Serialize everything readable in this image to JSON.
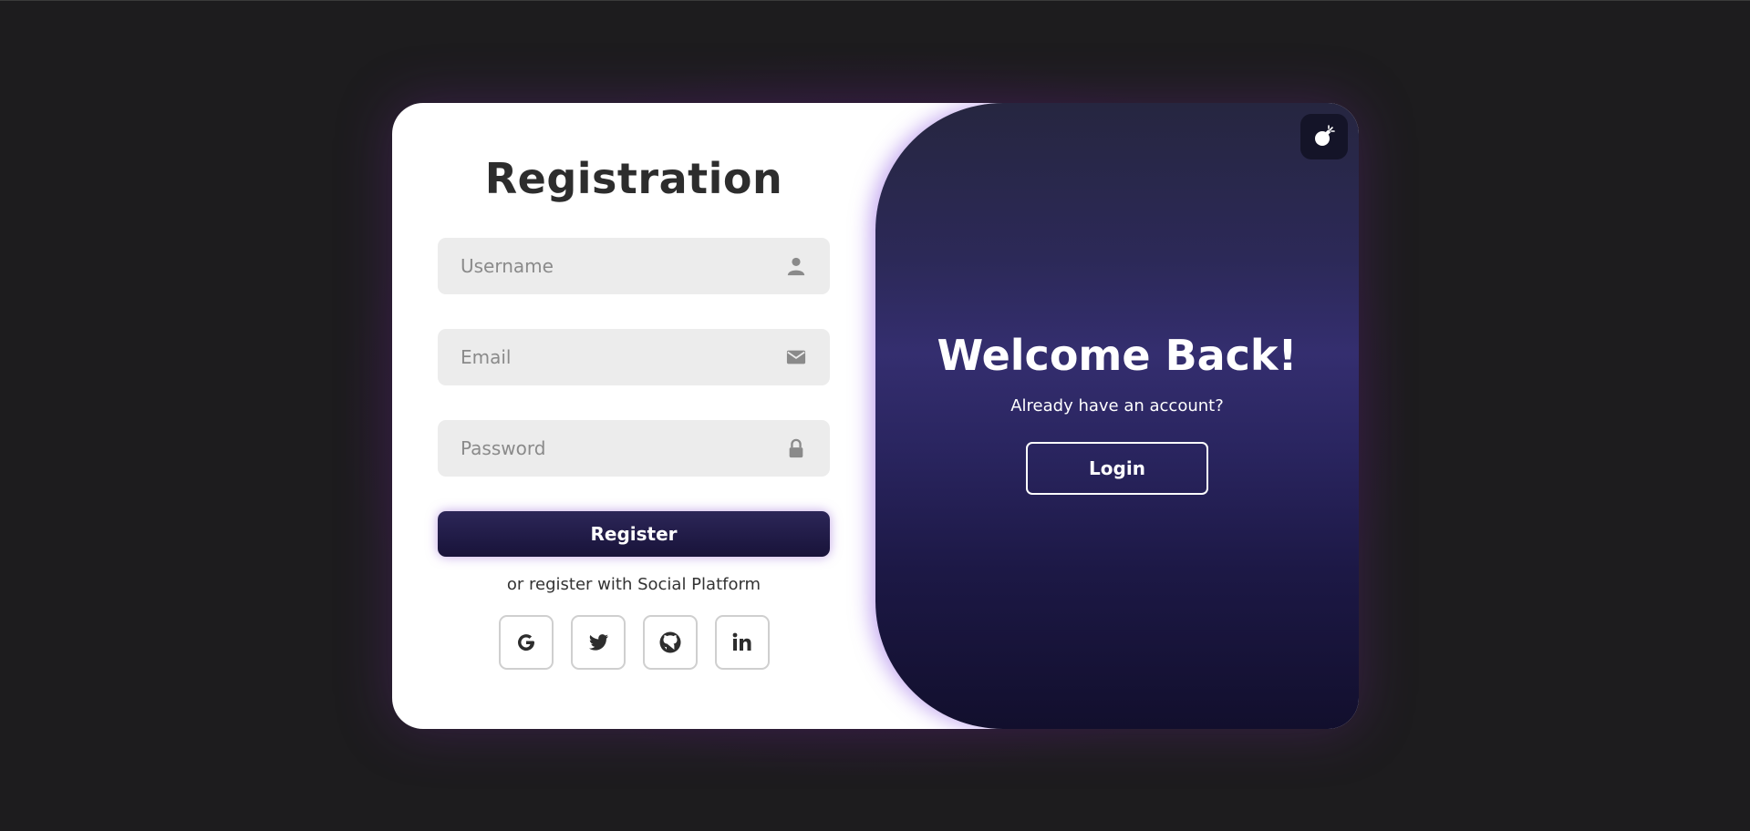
{
  "form": {
    "title": "Registration",
    "username_placeholder": "Username",
    "email_placeholder": "Email",
    "password_placeholder": "Password",
    "register_label": "Register",
    "social_text": "or register with Social Platform",
    "socials": [
      {
        "name": "google-icon",
        "glyph": "G"
      },
      {
        "name": "twitter-icon",
        "glyph": "twitter"
      },
      {
        "name": "github-icon",
        "glyph": "github"
      },
      {
        "name": "linkedin-icon",
        "glyph": "in"
      }
    ]
  },
  "toggle": {
    "title": "Welcome Back!",
    "subtitle": "Already have an account?",
    "login_label": "Login",
    "corner_icon": "bomb-icon"
  },
  "colors": {
    "page_bg": "#1d1c1e",
    "button_dark": "#181339",
    "panel_mid": "#342e6f",
    "field_bg": "#ececec",
    "icon_gray": "#8a8a8a"
  }
}
